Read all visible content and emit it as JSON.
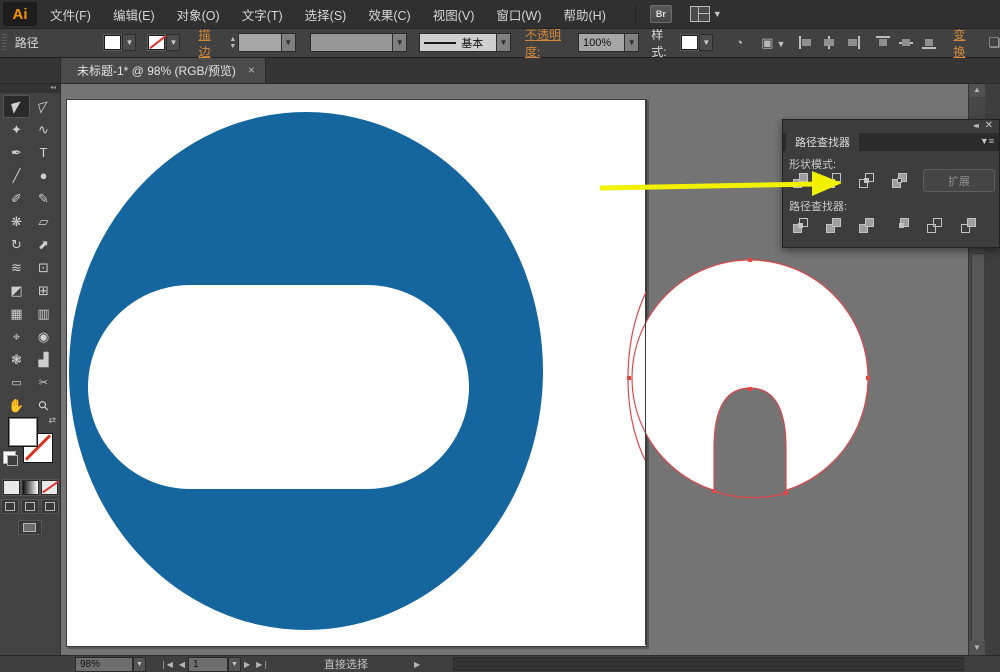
{
  "app": {
    "logo_text": "Ai"
  },
  "menubar": {
    "items": [
      "文件(F)",
      "编辑(E)",
      "对象(O)",
      "文字(T)",
      "选择(S)",
      "效果(C)",
      "视图(V)",
      "窗口(W)",
      "帮助(H)"
    ],
    "bridge_button": "Br",
    "workspace_icon": "workspace-switcher-icon"
  },
  "control_bar": {
    "panel_label": "路径",
    "stroke_link": "描边",
    "brush_value": "基本",
    "opacity_link": "不透明度:",
    "opacity_value": "100%",
    "style_label": "样式:",
    "transform_link": "变换",
    "align_icons": [
      "align-left",
      "align-center",
      "align-right",
      "align-top",
      "align-middle",
      "align-bottom"
    ]
  },
  "document_tab": {
    "title": "未标题-1* @ 98% (RGB/预览)",
    "close_glyph": "×"
  },
  "toolbar": {
    "active_tool": "selection-tool",
    "tools": [
      {
        "name": "selection-tool",
        "glyph": "◤"
      },
      {
        "name": "direct-selection-tool",
        "glyph": "◸"
      },
      {
        "name": "magic-wand-tool",
        "glyph": "✦"
      },
      {
        "name": "lasso-tool",
        "glyph": "∿"
      },
      {
        "name": "pen-tool",
        "glyph": "✒"
      },
      {
        "name": "type-tool",
        "glyph": "T"
      },
      {
        "name": "line-segment-tool",
        "glyph": "╱"
      },
      {
        "name": "ellipse-tool",
        "glyph": "●"
      },
      {
        "name": "paintbrush-tool",
        "glyph": "✐"
      },
      {
        "name": "pencil-tool",
        "glyph": "✎"
      },
      {
        "name": "blob-brush-tool",
        "glyph": "❋"
      },
      {
        "name": "eraser-tool",
        "glyph": "▱"
      },
      {
        "name": "rotate-tool",
        "glyph": "↻"
      },
      {
        "name": "scale-tool",
        "glyph": "⬈"
      },
      {
        "name": "width-tool",
        "glyph": "≋"
      },
      {
        "name": "free-transform-tool",
        "glyph": "⊡"
      },
      {
        "name": "shape-builder-tool",
        "glyph": "◩"
      },
      {
        "name": "perspective-grid-tool",
        "glyph": "⊞"
      },
      {
        "name": "mesh-tool",
        "glyph": "▦"
      },
      {
        "name": "gradient-tool",
        "glyph": "▥"
      },
      {
        "name": "eyedropper-tool",
        "glyph": "⌖"
      },
      {
        "name": "blend-tool",
        "glyph": "◉"
      },
      {
        "name": "symbol-sprayer-tool",
        "glyph": "❃"
      },
      {
        "name": "column-graph-tool",
        "glyph": "▟"
      },
      {
        "name": "artboard-tool",
        "glyph": "▭"
      },
      {
        "name": "slice-tool",
        "glyph": "✂"
      },
      {
        "name": "hand-tool",
        "glyph": "✋"
      },
      {
        "name": "zoom-tool",
        "glyph": "⚲"
      }
    ]
  },
  "pathfinder_panel": {
    "tab_title": "路径查找器",
    "shape_modes_label": "形状模式:",
    "expand_button": "扩展",
    "pathfinder_label": "路径查找器:",
    "shape_mode_buttons": [
      "unite",
      "minus-front",
      "intersect",
      "exclude"
    ],
    "pathfinder_buttons": [
      "divide",
      "trim",
      "merge",
      "crop",
      "outline",
      "minus-back"
    ]
  },
  "status_bar": {
    "zoom_value": "98%",
    "artboard_value": "1",
    "tool_name": "直接选择"
  },
  "canvas": {
    "colors": {
      "shape_blue": "#15669E",
      "selection_path_red": "#E14747",
      "annotation_arrow_yellow": "#F2F200",
      "artboard_white": "#FFFFFF",
      "pasteboard_gray": "#747474"
    }
  }
}
